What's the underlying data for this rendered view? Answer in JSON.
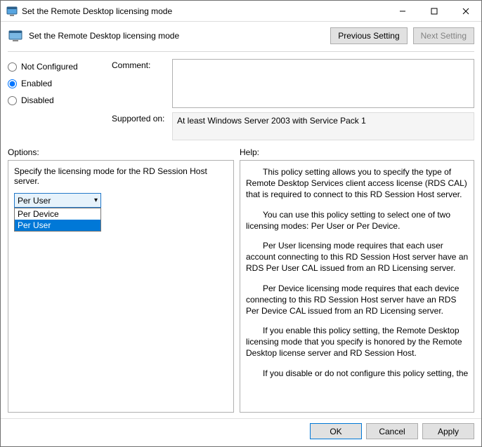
{
  "window": {
    "title": "Set the Remote Desktop licensing mode"
  },
  "toolbar": {
    "title": "Set the Remote Desktop licensing mode",
    "prev_label": "Previous Setting",
    "next_label": "Next Setting"
  },
  "state": {
    "not_configured_label": "Not Configured",
    "enabled_label": "Enabled",
    "disabled_label": "Disabled",
    "selected": "Enabled"
  },
  "comment": {
    "label": "Comment:",
    "value": ""
  },
  "supported": {
    "label": "Supported on:",
    "value": "At least Windows Server 2003 with Service Pack 1"
  },
  "sections": {
    "options_label": "Options:",
    "help_label": "Help:"
  },
  "options": {
    "description": "Specify the licensing mode for the RD Session Host server.",
    "combo": {
      "selected": "Per User",
      "items": [
        "Per Device",
        "Per User"
      ],
      "highlighted": "Per User"
    }
  },
  "help": {
    "paragraphs": [
      "This policy setting allows you to specify the type of Remote Desktop Services client access license (RDS CAL) that is required to connect to this RD Session Host server.",
      "You can use this policy setting to select one of two licensing modes: Per User or Per Device.",
      "Per User licensing mode requires that each user account connecting to this RD Session Host server have an RDS Per User CAL issued from an RD Licensing server.",
      "Per Device licensing mode requires that each device connecting to this RD Session Host server have an RDS Per Device CAL issued from an RD Licensing server.",
      "If you enable this policy setting, the Remote Desktop licensing mode that you specify is honored by the Remote Desktop license server and RD Session Host.",
      "If you disable or do not configure this policy setting, the"
    ]
  },
  "footer": {
    "ok": "OK",
    "cancel": "Cancel",
    "apply": "Apply"
  }
}
